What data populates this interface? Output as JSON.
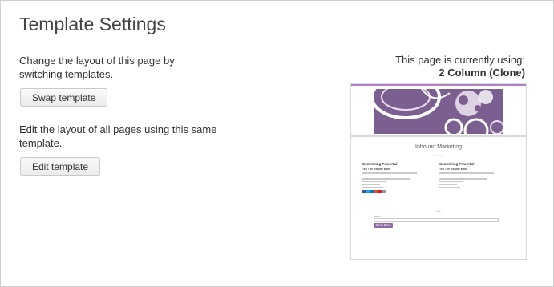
{
  "page": {
    "title": "Template Settings"
  },
  "swap": {
    "description": "Change the layout of this page by switching templates.",
    "button_label": "Swap template"
  },
  "edit": {
    "description": "Edit the layout of all pages using this same template.",
    "button_label": "Edit template"
  },
  "current": {
    "label": "This page is currently using:",
    "template_name": "2 Column (Clone)"
  },
  "preview": {
    "site_title": "Inbound Marketing",
    "column_heading": "Something Powerful",
    "column_subheading": "Tell The Reader More",
    "button_label": "Submit Button"
  },
  "colors": {
    "accent": "#8e6aa3",
    "banner": "#7c5f91"
  }
}
